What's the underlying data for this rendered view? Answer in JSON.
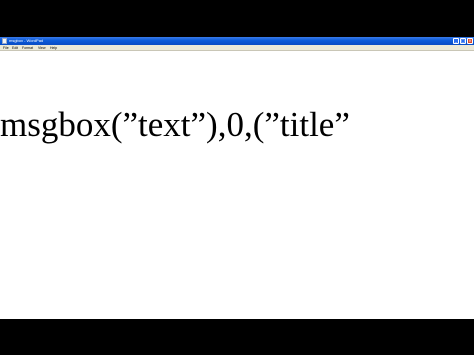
{
  "window": {
    "title": "msgbox - WordPad"
  },
  "controls": {
    "minimize": "_",
    "maximize": "□",
    "close": "×"
  },
  "menu": [
    {
      "label": "File"
    },
    {
      "label": "Edit"
    },
    {
      "label": "Format"
    },
    {
      "label": "View"
    },
    {
      "label": "Help"
    }
  ],
  "document": {
    "text": "msgbox(”text”),0,(”title”"
  }
}
